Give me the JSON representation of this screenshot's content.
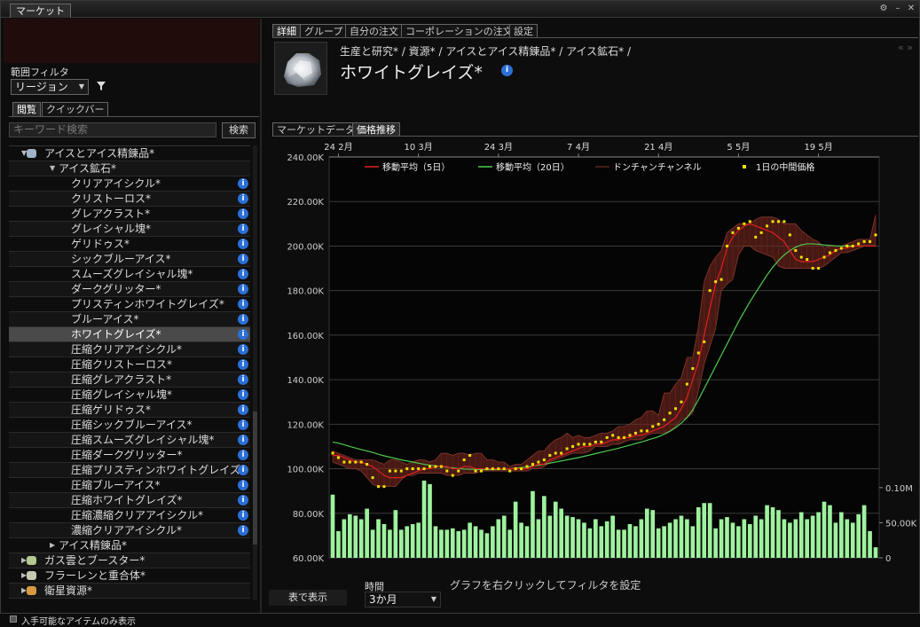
{
  "window": {
    "tab": "マーケット"
  },
  "left": {
    "range_filter_label": "範囲フィルタ",
    "range_select": "リージョン",
    "tabs": [
      "閲覧",
      "クイックバー"
    ],
    "search_placeholder": "キーワード検索",
    "search_button": "検索",
    "tree": [
      {
        "label": "アイスとアイス精錬品*",
        "level": 1,
        "expanded": true,
        "icon": "ice-group"
      },
      {
        "label": "アイス鉱石*",
        "level": 2,
        "expanded": true
      },
      {
        "label": "クリアアイシクル*",
        "level": 3,
        "info": true
      },
      {
        "label": "クリストーロス*",
        "level": 3,
        "info": true
      },
      {
        "label": "グレアクラスト*",
        "level": 3,
        "info": true
      },
      {
        "label": "グレイシャル塊*",
        "level": 3,
        "info": true
      },
      {
        "label": "ゲリドゥス*",
        "level": 3,
        "info": true
      },
      {
        "label": "シックブルーアイス*",
        "level": 3,
        "info": true
      },
      {
        "label": "スムーズグレイシャル塊*",
        "level": 3,
        "info": true
      },
      {
        "label": "ダークグリッター*",
        "level": 3,
        "info": true
      },
      {
        "label": "プリスティンホワイトグレイズ*",
        "level": 3,
        "info": true
      },
      {
        "label": "ブルーアイス*",
        "level": 3,
        "info": true
      },
      {
        "label": "ホワイトグレイズ*",
        "level": 3,
        "info": true,
        "selected": true
      },
      {
        "label": "圧縮クリアアイシクル*",
        "level": 3,
        "info": true
      },
      {
        "label": "圧縮クリストーロス*",
        "level": 3,
        "info": true
      },
      {
        "label": "圧縮グレアクラスト*",
        "level": 3,
        "info": true
      },
      {
        "label": "圧縮グレイシャル塊*",
        "level": 3,
        "info": true
      },
      {
        "label": "圧縮ゲリドゥス*",
        "level": 3,
        "info": true
      },
      {
        "label": "圧縮シックブルーアイス*",
        "level": 3,
        "info": true
      },
      {
        "label": "圧縮スムーズグレイシャル塊*",
        "level": 3,
        "info": true
      },
      {
        "label": "圧縮ダークグリッター*",
        "level": 3,
        "info": true
      },
      {
        "label": "圧縮プリスティンホワイトグレイズ*",
        "level": 3,
        "info": true
      },
      {
        "label": "圧縮ブルーアイス*",
        "level": 3,
        "info": true
      },
      {
        "label": "圧縮ホワイトグレイズ*",
        "level": 3,
        "info": true
      },
      {
        "label": "圧縮濃縮クリアアイシクル*",
        "level": 3,
        "info": true
      },
      {
        "label": "濃縮クリアアイシクル*",
        "level": 3,
        "info": true
      },
      {
        "label": "アイス精錬品*",
        "level": 2,
        "expanded": false
      },
      {
        "label": "ガス雲とブースター*",
        "level": 1,
        "expanded": false,
        "icon": "gas-cloud"
      },
      {
        "label": "フラーレンと重合体*",
        "level": 1,
        "expanded": false,
        "icon": "fullerene"
      },
      {
        "label": "衛星資源*",
        "level": 1,
        "expanded": false,
        "icon": "moon-resource"
      }
    ],
    "only_available": "入手可能なアイテムのみ表示"
  },
  "right": {
    "tabs": [
      "詳細",
      "グループ",
      "自分の注文",
      "コーポレーションの注文",
      "設定"
    ],
    "breadcrumb": "生産と研究* / 資源* / アイスとアイス精錬品* / アイス鉱石* /",
    "title": "ホワイトグレイズ*",
    "subtabs": [
      "マーケットデータ",
      "価格推移"
    ],
    "table_button": "表で表示",
    "period_label": "時間",
    "period_value": "3か月",
    "hint": "グラフを右クリックしてフィルタを設定"
  },
  "colors": {
    "ma5": "#e02020",
    "ma20": "#4fc94f",
    "donchian": "#7a2a20",
    "median": "#f5e000",
    "volume": "#9ef29e",
    "info": "#2b6fd6"
  },
  "chart_data": {
    "type": "line",
    "legend": [
      "移動平均（5日）",
      "移動平均（20日）",
      "ドンチャンチャンネル",
      "1日の中間価格"
    ],
    "x_tick_labels": [
      "24 2月",
      "10 3月",
      "24 3月",
      "7 4月",
      "21 4月",
      "5 5月",
      "19 5月"
    ],
    "x_tick_index": [
      1,
      15,
      29,
      43,
      57,
      71,
      85
    ],
    "ylim": [
      60000,
      240000
    ],
    "y_tick_labels": [
      "240.00K",
      "220.00K",
      "200.00K",
      "180.00K",
      "160.00K",
      "140.00K",
      "120.00K",
      "100.00K",
      "80.00K",
      "60.00K"
    ],
    "volume_tick_labels": [
      "0.10M",
      "50.00K",
      "0"
    ],
    "volume_max": 120000,
    "median": [
      107000,
      105000,
      103000,
      103000,
      103000,
      103000,
      102000,
      96000,
      92000,
      92000,
      99000,
      99000,
      99000,
      100000,
      100000,
      100000,
      100000,
      101000,
      101000,
      101000,
      99000,
      97000,
      99000,
      104000,
      106000,
      99000,
      99000,
      100000,
      100000,
      100000,
      100000,
      99000,
      100000,
      100000,
      101000,
      102000,
      103000,
      104000,
      106000,
      107000,
      107000,
      109000,
      110000,
      111000,
      111000,
      111000,
      112000,
      112000,
      114000,
      115000,
      114000,
      114000,
      115000,
      116000,
      117000,
      117000,
      119000,
      120000,
      122000,
      125000,
      127000,
      130000,
      138000,
      145000,
      152000,
      157000,
      180000,
      184000,
      185000,
      200000,
      206000,
      208000,
      210000,
      211000,
      204000,
      206000,
      209000,
      211000,
      211000,
      211000,
      205000,
      198000,
      195000,
      194000,
      190000,
      190000,
      195000,
      197000,
      198000,
      199000,
      200000,
      200000,
      201000,
      202000,
      202000,
      205000
    ],
    "donchian_high": [
      108000,
      107000,
      106000,
      105000,
      104000,
      104000,
      104000,
      104000,
      103000,
      102000,
      104000,
      104000,
      103000,
      102000,
      103000,
      104000,
      104000,
      103000,
      104000,
      107000,
      107000,
      106000,
      107000,
      107000,
      106000,
      107000,
      107000,
      104000,
      104000,
      103000,
      103000,
      101000,
      102000,
      102000,
      104000,
      106000,
      108000,
      108000,
      111000,
      113000,
      114000,
      116000,
      114000,
      115000,
      114000,
      114000,
      115000,
      116000,
      116000,
      117000,
      119000,
      119000,
      120000,
      122000,
      123000,
      126000,
      126000,
      124000,
      134000,
      134000,
      138000,
      141000,
      150000,
      150000,
      164000,
      184000,
      191000,
      195000,
      198000,
      206000,
      208000,
      210000,
      210000,
      210000,
      212000,
      213000,
      213000,
      213000,
      212000,
      210000,
      210000,
      210000,
      207000,
      205000,
      203000,
      202000,
      199000,
      200000,
      200000,
      200000,
      201000,
      202000,
      203000,
      203000,
      203000,
      214000
    ],
    "donchian_low": [
      103000,
      102000,
      101000,
      100000,
      100000,
      99000,
      96000,
      93000,
      92000,
      92000,
      92000,
      92000,
      95000,
      97000,
      97000,
      98000,
      98000,
      98000,
      98000,
      98000,
      97000,
      97000,
      97000,
      98000,
      98000,
      98000,
      99000,
      99000,
      99000,
      99000,
      99000,
      99000,
      99000,
      99000,
      99000,
      100000,
      100000,
      101000,
      103000,
      104000,
      105000,
      106000,
      107000,
      107000,
      107000,
      108000,
      110000,
      110000,
      110000,
      111000,
      111000,
      112000,
      113000,
      113000,
      113000,
      115000,
      116000,
      116000,
      116000,
      117000,
      119000,
      122000,
      123000,
      125000,
      135000,
      147000,
      155000,
      163000,
      180000,
      183000,
      185000,
      196000,
      200000,
      200000,
      198000,
      197000,
      196000,
      195000,
      191000,
      190000,
      190000,
      190000,
      190000,
      190000,
      190000,
      190000,
      191000,
      193000,
      195000,
      197000,
      197000,
      198000,
      199000,
      200000,
      200000,
      200000
    ],
    "ma5": [
      106000,
      106000,
      105000,
      104000,
      103000,
      103000,
      102000,
      101000,
      99000,
      97000,
      96000,
      96000,
      96000,
      97000,
      98000,
      99000,
      100000,
      100000,
      101000,
      101000,
      101000,
      100000,
      100000,
      101000,
      101000,
      100000,
      100000,
      100000,
      100000,
      100000,
      100000,
      100000,
      100000,
      100000,
      100000,
      101000,
      102000,
      102000,
      104000,
      105000,
      106000,
      107000,
      108000,
      109000,
      110000,
      110000,
      111000,
      111000,
      112000,
      113000,
      113000,
      114000,
      114000,
      115000,
      115000,
      116000,
      117000,
      118000,
      119000,
      121000,
      123000,
      127000,
      132000,
      140000,
      148000,
      160000,
      172000,
      183000,
      190000,
      199000,
      204000,
      207000,
      209000,
      210000,
      209000,
      208000,
      207000,
      206000,
      204000,
      202000,
      198000,
      194000,
      193000,
      193000,
      193000,
      194000,
      195000,
      196000,
      198000,
      199000,
      199000,
      200000,
      200000,
      200000,
      200000,
      200000
    ],
    "ma20": [
      112000,
      111500,
      110800,
      110000,
      109300,
      108600,
      108000,
      107300,
      106500,
      105800,
      105200,
      104600,
      104000,
      103500,
      103000,
      102500,
      102000,
      101600,
      101300,
      101000,
      100700,
      100400,
      100100,
      99900,
      99800,
      99700,
      99600,
      99600,
      99600,
      99700,
      99800,
      100000,
      100200,
      100500,
      100800,
      101200,
      101600,
      102000,
      102500,
      103000,
      103500,
      104000,
      104500,
      105000,
      105600,
      106200,
      106800,
      107400,
      108000,
      108600,
      109200,
      109900,
      110600,
      111300,
      112000,
      112800,
      113600,
      114400,
      115500,
      116800,
      118500,
      120500,
      123000,
      126500,
      131000,
      136000,
      141000,
      146000,
      151000,
      156000,
      161000,
      166000,
      170500,
      175000,
      179000,
      183000,
      187000,
      190500,
      193500,
      196000,
      198000,
      199500,
      200500,
      201000,
      201000,
      200800,
      200500,
      200300,
      200100,
      200000,
      200000,
      200000,
      200000,
      200000,
      200000,
      200000
    ],
    "volume": [
      90000,
      38000,
      55000,
      62000,
      60000,
      55000,
      70000,
      40000,
      55000,
      48000,
      40000,
      68000,
      40000,
      45000,
      48000,
      50000,
      110000,
      105000,
      45000,
      40000,
      40000,
      42000,
      38000,
      40000,
      50000,
      45000,
      40000,
      35000,
      45000,
      55000,
      60000,
      40000,
      80000,
      50000,
      45000,
      95000,
      55000,
      88000,
      60000,
      80000,
      70000,
      60000,
      58000,
      55000,
      50000,
      42000,
      55000,
      45000,
      52000,
      60000,
      40000,
      40000,
      48000,
      45000,
      55000,
      70000,
      68000,
      42000,
      45000,
      50000,
      55000,
      60000,
      55000,
      45000,
      72000,
      78000,
      78000,
      42000,
      55000,
      58000,
      50000,
      45000,
      55000,
      48000,
      60000,
      55000,
      75000,
      72000,
      68000,
      55000,
      50000,
      55000,
      65000,
      55000,
      60000,
      65000,
      80000,
      75000,
      50000,
      65000,
      55000,
      50000,
      62000,
      75000,
      38000,
      15000
    ]
  }
}
